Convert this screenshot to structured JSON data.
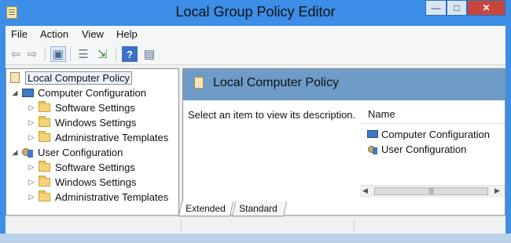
{
  "window": {
    "title": "Local Group Policy Editor",
    "minimize": "—",
    "maximize": "□",
    "close": "✕"
  },
  "menu": [
    "File",
    "Action",
    "View",
    "Help"
  ],
  "toolbar": {
    "icons": [
      "back-arrow-icon",
      "forward-arrow-icon",
      "show-hide-console-tree-icon",
      "properties-icon",
      "export-list-icon",
      "help-icon",
      "show-hide-action-pane-icon"
    ],
    "glyphs": {
      "back": "⇦",
      "forward": "⇨",
      "console": "▣",
      "properties": "☰",
      "export": "⇲",
      "help": "?",
      "action": "▤"
    }
  },
  "tree": {
    "root": "Local Computer Policy",
    "computer_configuration": "Computer Configuration",
    "user_configuration": "User Configuration",
    "software_settings": "Software Settings",
    "windows_settings": "Windows Settings",
    "administrative_templates": "Administrative Templates"
  },
  "right_pane": {
    "header_title": "Local Computer Policy",
    "description": "Select an item to view its description.",
    "column_name": "Name",
    "items": [
      "Computer Configuration",
      "User Configuration"
    ]
  },
  "tabs": [
    "Extended",
    "Standard"
  ],
  "colors": {
    "title_bar": "#3c8ee6",
    "header_band": "#6e9bc8",
    "close_button": "#c7463b"
  }
}
